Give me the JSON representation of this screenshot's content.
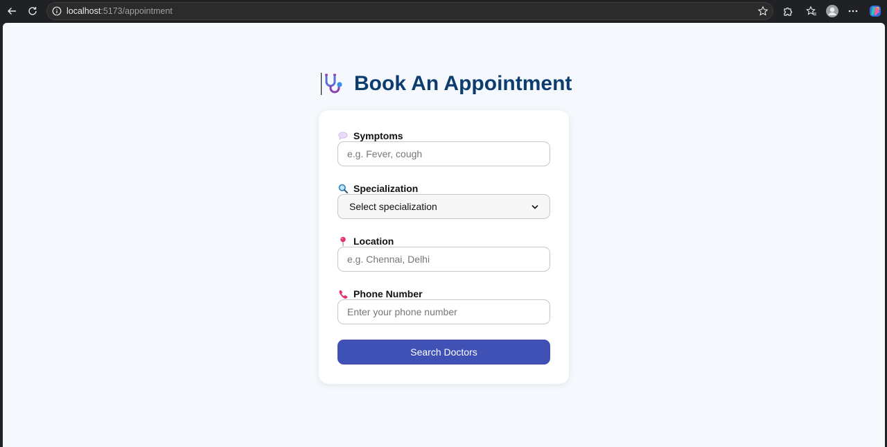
{
  "browser": {
    "url_host": "localhost",
    "url_path": ":5173/appointment"
  },
  "page": {
    "title": "Book An Appointment"
  },
  "form": {
    "symptoms": {
      "label": "Symptoms",
      "placeholder": "e.g. Fever, cough",
      "value": ""
    },
    "specialization": {
      "label": "Specialization",
      "selected": "Select specialization"
    },
    "location": {
      "label": "Location",
      "placeholder": "e.g. Chennai, Delhi",
      "value": ""
    },
    "phone": {
      "label": "Phone Number",
      "placeholder": "Enter your phone number",
      "value": ""
    },
    "submit_label": "Search Doctors"
  },
  "icons": {
    "heading": "stethoscope-icon",
    "symptoms": "speech-bubble-icon",
    "specialization": "magnifier-icon",
    "location": "pin-icon",
    "phone": "phone-icon"
  },
  "colors": {
    "title": "#0d3c6e",
    "button": "#3f51b5",
    "page_bg": "#f5f9fd"
  }
}
